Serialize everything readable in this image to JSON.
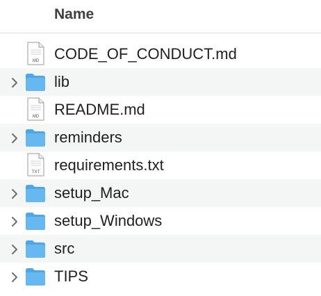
{
  "header": {
    "name_label": "Name"
  },
  "files": [
    {
      "name": "CODE_OF_CONDUCT.md",
      "kind": "file",
      "icon": "md-file-icon",
      "badge": "MD"
    },
    {
      "name": "lib",
      "kind": "folder",
      "icon": "folder-icon"
    },
    {
      "name": "README.md",
      "kind": "file",
      "icon": "md-file-icon",
      "badge": "MD"
    },
    {
      "name": "reminders",
      "kind": "folder",
      "icon": "folder-icon"
    },
    {
      "name": "requirements.txt",
      "kind": "file",
      "icon": "txt-file-icon",
      "badge": "TXT"
    },
    {
      "name": "setup_Mac",
      "kind": "folder",
      "icon": "folder-icon"
    },
    {
      "name": "setup_Windows",
      "kind": "folder",
      "icon": "folder-icon"
    },
    {
      "name": "src",
      "kind": "folder",
      "icon": "folder-icon"
    },
    {
      "name": "TIPS",
      "kind": "folder",
      "icon": "folder-icon"
    }
  ],
  "colors": {
    "folder_front": "#67b8f0",
    "folder_back": "#4ea6e6",
    "row_alt": "#f4f5f5",
    "header_border": "#dcdcdc"
  }
}
